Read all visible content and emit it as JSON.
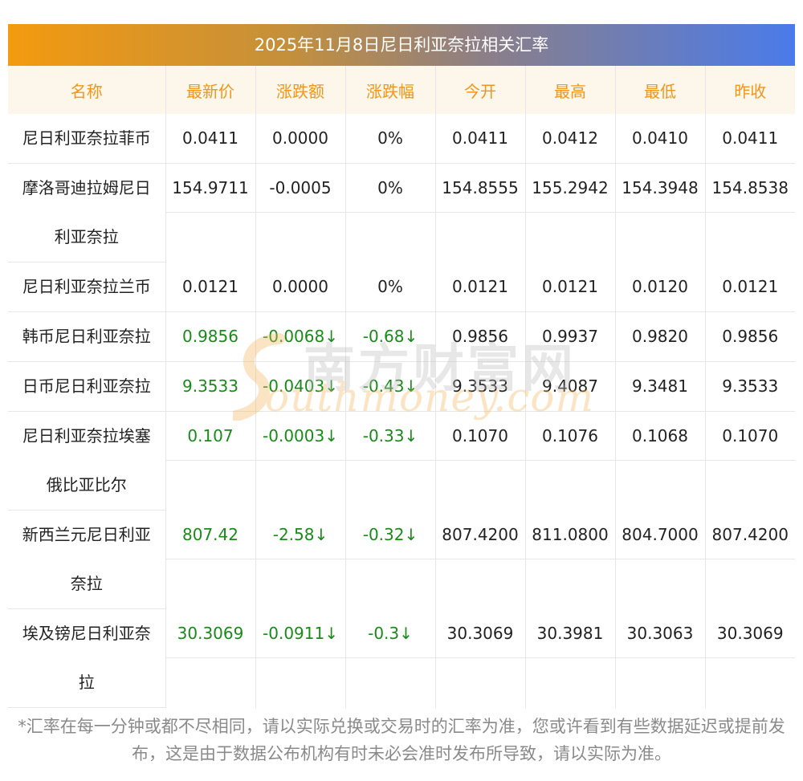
{
  "title": "2025年11月8日尼日利亚奈拉相关汇率",
  "columns": [
    "名称",
    "最新价",
    "涨跌额",
    "涨跌幅",
    "今开",
    "最高",
    "最低",
    "昨收"
  ],
  "rows": [
    {
      "name": "尼日利亚奈拉菲币",
      "latest": "0.0411",
      "change": "0.0000",
      "change_pct": "0%",
      "open": "0.0411",
      "high": "0.0412",
      "low": "0.0410",
      "prev_close": "0.0411",
      "color": "#222222"
    },
    {
      "name": "摩洛哥迪拉姆尼日利亚奈拉",
      "latest": "154.9711",
      "change": "-0.0005",
      "change_pct": "0%",
      "open": "154.8555",
      "high": "155.2942",
      "low": "154.3948",
      "prev_close": "154.8538",
      "color": "#222222"
    },
    {
      "name": "尼日利亚奈拉兰币",
      "latest": "0.0121",
      "change": "0.0000",
      "change_pct": "0%",
      "open": "0.0121",
      "high": "0.0121",
      "low": "0.0120",
      "prev_close": "0.0121",
      "color": "#222222"
    },
    {
      "name": "韩币尼日利亚奈拉",
      "latest": "0.9856",
      "change": "-0.0068↓",
      "change_pct": "-0.68↓",
      "open": "0.9856",
      "high": "0.9937",
      "low": "0.9820",
      "prev_close": "0.9856",
      "color": "#1a8a1a"
    },
    {
      "name": "日币尼日利亚奈拉",
      "latest": "9.3533",
      "change": "-0.0403↓",
      "change_pct": "-0.43↓",
      "open": "9.3533",
      "high": "9.4087",
      "low": "9.3481",
      "prev_close": "9.3533",
      "color": "#1a8a1a"
    },
    {
      "name": "尼日利亚奈拉埃塞俄比亚比尔",
      "latest": "0.107",
      "change": "-0.0003↓",
      "change_pct": "-0.33↓",
      "open": "0.1070",
      "high": "0.1076",
      "low": "0.1068",
      "prev_close": "0.1070",
      "color": "#1a8a1a"
    },
    {
      "name": "新西兰元尼日利亚奈拉",
      "latest": "807.42",
      "change": "-2.58↓",
      "change_pct": "-0.32↓",
      "open": "807.4200",
      "high": "811.0800",
      "low": "804.7000",
      "prev_close": "807.4200",
      "color": "#1a8a1a"
    },
    {
      "name": "埃及镑尼日利亚奈拉",
      "latest": "30.3069",
      "change": "-0.0911↓",
      "change_pct": "-0.3↓",
      "open": "30.3069",
      "high": "30.3981",
      "low": "30.3063",
      "prev_close": "30.3069",
      "color": "#1a8a1a"
    }
  ],
  "watermark": {
    "cn": "南方财富网",
    "en": "outhmoney.com"
  },
  "footnote": "*汇率在每一分钟或都不尽相同，请以实际兑换或交易时的汇率为准，您或许看到有些数据延迟或提前发布，这是由于数据公布机构有时未必会准时发布所导致，请以实际为准。"
}
